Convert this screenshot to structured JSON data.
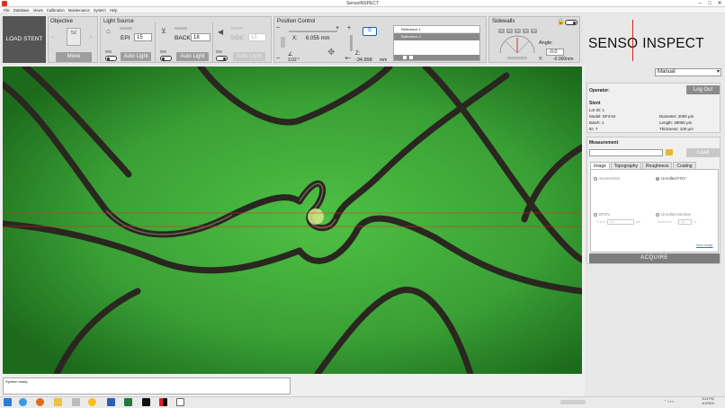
{
  "window": {
    "title": "SensoINSPECT",
    "controls": [
      "–",
      "□",
      "✕"
    ]
  },
  "menu": [
    "File",
    "Database",
    "Views",
    "Calibration",
    "Maintenance",
    "System",
    "Help"
  ],
  "load_stent": "LOAD STENT",
  "objective": {
    "title": "Objective",
    "magnification": "5X",
    "move": "Move"
  },
  "light_source": {
    "title": "Light Source",
    "epi": {
      "label": "EPI",
      "value": "15",
      "toggle": "ON",
      "auto": "Auto Light"
    },
    "back": {
      "label": "BACK",
      "value": "18",
      "toggle": "ON",
      "auto": "Auto Light"
    },
    "side": {
      "label": "SIDE",
      "value": "15",
      "toggle": "ON",
      "auto": "Auto Light"
    }
  },
  "position": {
    "title": "Position Control",
    "x_label": "X:",
    "x_value": "6.055 mm",
    "angle_value": "3.02 °",
    "z_label": "Z:",
    "z_value": "-34.998",
    "z_unit": "mm",
    "references": [
      "Reference 1",
      "Reference 2"
    ]
  },
  "sidewalls": {
    "title": "Sidewalls",
    "buttons": [
      "R1",
      "R2",
      "R3",
      "R4",
      "R5"
    ],
    "angle_label": "Angle:",
    "angle_value": "-0.0",
    "y_label": "Y:",
    "y_value": "-0.000mm"
  },
  "brand": {
    "left": "SENSO",
    "right": "INSPECT"
  },
  "mode": "Manual",
  "operator": {
    "label": "Operator:",
    "logout": "Log Out"
  },
  "stent": {
    "title": "Stent",
    "lot": {
      "label": "Lot ID:",
      "value": "1"
    },
    "model": {
      "label": "Model:",
      "value": "DFS-M"
    },
    "batch": {
      "label": "Batch:",
      "value": "1"
    },
    "id": {
      "label": "ID:",
      "value": "7"
    },
    "diameter": {
      "label": "Diameter:",
      "value": "2000 μm"
    },
    "length": {
      "label": "Length:",
      "value": "39000 μm"
    },
    "thickness": {
      "label": "Thickness:",
      "value": "100 μm"
    }
  },
  "measurement": {
    "title": "Measurement",
    "load": "Load",
    "tabs": [
      "Image",
      "Topography",
      "Roughness",
      "Coating"
    ],
    "opt_screenshot": "Screenshot",
    "opt_unrolled_fov": "Unrolled FOV",
    "opt_efov": "EFOV",
    "opt_unrolled_section": "Unrolled Section",
    "efov_label": "X-size:",
    "efov_value": "10",
    "efov_unit": "μm",
    "section_label": "Increment:",
    "section_value": "15",
    "section_unit": "%",
    "save_recipe": "Save recipe",
    "acquire": "ACQUIRE"
  },
  "status": {
    "text": "System ready"
  },
  "clock": {
    "time": "5:24 PM",
    "date": "4/1/2019"
  },
  "colors": {
    "accent_red": "#d4201f",
    "field_green": "#43a83d",
    "button_gray": "#9e9e9e"
  }
}
